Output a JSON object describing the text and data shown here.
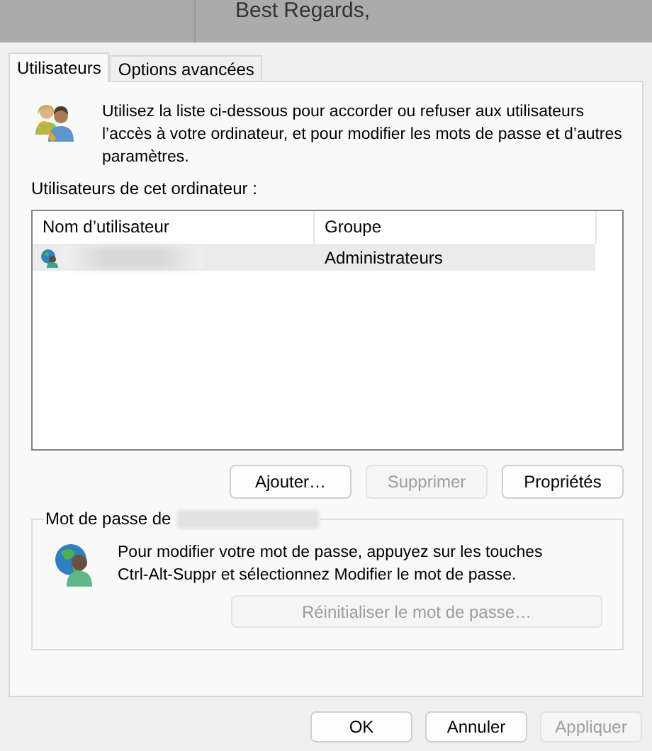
{
  "background_window": {
    "text": "Best Regards,"
  },
  "tabs": [
    {
      "label": "Utilisateurs",
      "selected": true
    },
    {
      "label": "Options avancées",
      "selected": false
    }
  ],
  "intro": "Utilisez la liste ci-dessous pour accorder ou refuser aux utilisateurs l’accès à votre ordinateur, et pour modifier les mots de passe et d’autres paramètres.",
  "users_label": "Utilisateurs de cet ordinateur :",
  "table": {
    "columns": [
      "Nom d’utilisateur",
      "Groupe"
    ],
    "rows": [
      {
        "group": "Administrateurs",
        "selected": true
      }
    ]
  },
  "user_buttons": [
    {
      "label": "Ajouter…",
      "disabled": false
    },
    {
      "label": "Supprimer",
      "disabled": true
    },
    {
      "label": "Propriétés",
      "disabled": false
    }
  ],
  "password_group": {
    "title": "Mot de passe de",
    "text": "Pour modifier votre mot de passe, appuyez sur les touches Ctrl-Alt-Suppr et sélectionnez Modifier le mot de passe.",
    "reset_button": {
      "label": "Réinitialiser le mot de passe…",
      "disabled": true
    }
  },
  "dialog_buttons": [
    {
      "label": "OK",
      "disabled": false
    },
    {
      "label": "Annuler",
      "disabled": false
    },
    {
      "label": "Appliquer",
      "disabled": true
    }
  ]
}
